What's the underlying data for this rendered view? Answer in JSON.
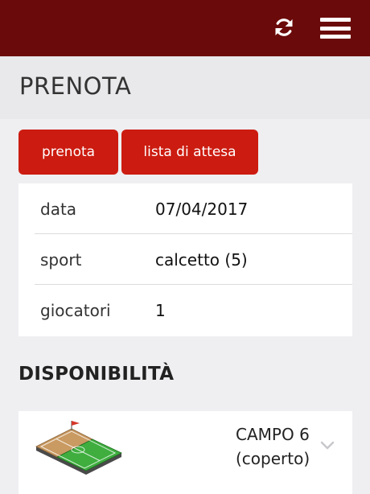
{
  "header": {
    "refresh_icon": "refresh-icon",
    "menu_icon": "hamburger-menu-icon",
    "bar_color": "#6b0a0a"
  },
  "page": {
    "title": "PRENOTA"
  },
  "actions": {
    "book_label": "prenota",
    "waitlist_label": "lista di attesa",
    "button_color": "#cc1b10"
  },
  "details": {
    "rows": [
      {
        "label": "data",
        "value": "07/04/2017"
      },
      {
        "label": "sport",
        "value": "calcetto (5)"
      },
      {
        "label": "giocatori",
        "value": "1"
      }
    ]
  },
  "availability": {
    "title": "DISPONIBILITÀ",
    "fields": [
      {
        "icon": "soccer-field-icon",
        "name_line1": "CAMPO 6",
        "name_line2": "(coperto)"
      }
    ]
  }
}
